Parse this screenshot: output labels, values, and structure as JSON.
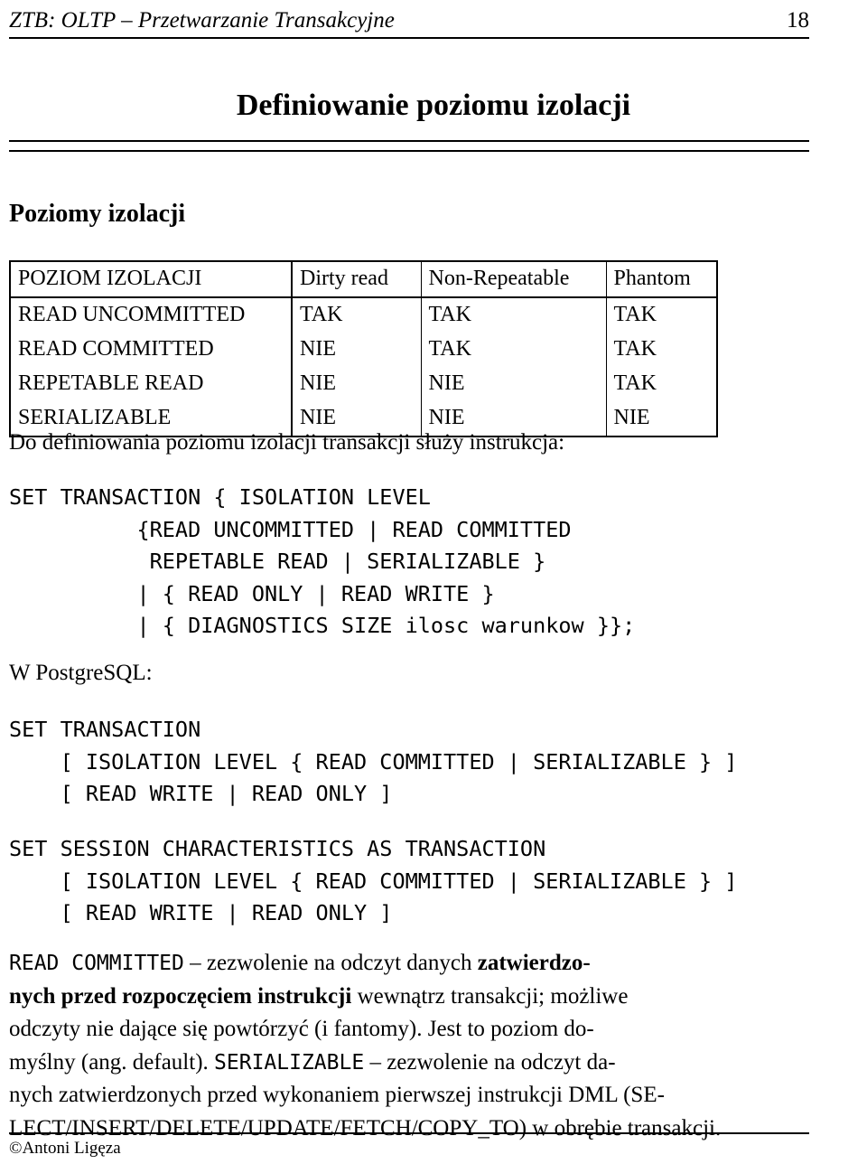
{
  "header": {
    "title": "ZTB: OLTP – Przetwarzanie Transakcyjne",
    "page_number": "18"
  },
  "slide": {
    "title": "Definiowanie poziomu izolacji",
    "section_heading": "Poziomy izolacji"
  },
  "table": {
    "columns": [
      "POZIOM IZOLACJI",
      "Dirty read",
      "Non-Repeatable",
      "Phantom"
    ],
    "rows": [
      {
        "level": "READ UNCOMMITTED",
        "dirty_read": "TAK",
        "non_repeatable": "TAK",
        "phantom": "TAK"
      },
      {
        "level": "READ COMMITTED",
        "dirty_read": "NIE",
        "non_repeatable": "TAK",
        "phantom": "TAK"
      },
      {
        "level": "REPETABLE READ",
        "dirty_read": "NIE",
        "non_repeatable": "NIE",
        "phantom": "TAK"
      },
      {
        "level": "SERIALIZABLE",
        "dirty_read": "NIE",
        "non_repeatable": "NIE",
        "phantom": "NIE"
      }
    ]
  },
  "intro_line": "Do definiowania poziomu izolacji transakcji służy instrukcja:",
  "sql_standard": "SET TRANSACTION { ISOLATION LEVEL\n          {READ UNCOMMITTED | READ COMMITTED\n           REPETABLE READ | SERIALIZABLE }\n          | { READ ONLY | READ WRITE }\n          | { DIAGNOSTICS SIZE ilosc warunkow }};",
  "postgres_label": "W PostgreSQL:",
  "sql_postgres_transaction": "SET TRANSACTION\n    [ ISOLATION LEVEL { READ COMMITTED | SERIALIZABLE } ]\n    [ READ WRITE | READ ONLY ]",
  "sql_postgres_session": "SET SESSION CHARACTERISTICS AS TRANSACTION\n    [ ISOLATION LEVEL { READ COMMITTED | SERIALIZABLE } ]\n    [ READ WRITE | READ ONLY ]",
  "description": {
    "line1_mono": "READ COMMITTED",
    "line1_rest_a": " – zezwolenie na odczyt danych ",
    "line1_bold": "zatwierdzo-",
    "line2_bold": "nych przed rozpoczęciem instrukcji",
    "line2_rest": " wewnątrz transakcji; możliwe",
    "line3": "odczyty nie dające się powtórzyć (i fantomy).   Jest to poziom do-",
    "line4_a": "myślny (ang.   default).   ",
    "line4_mono": "SERIALIZABLE",
    "line4_b": " – zezwolenie na odczyt da-",
    "line5": "nych zatwierdzonych przed wykonaniem pierwszej instrukcji DML (SE-",
    "line6": "LECT/INSERT/DELETE/UPDATE/FETCH/COPY_TO) w obrębie transakcji."
  },
  "footer": {
    "copyright_mark": "©",
    "author": "Antoni Ligęza"
  }
}
